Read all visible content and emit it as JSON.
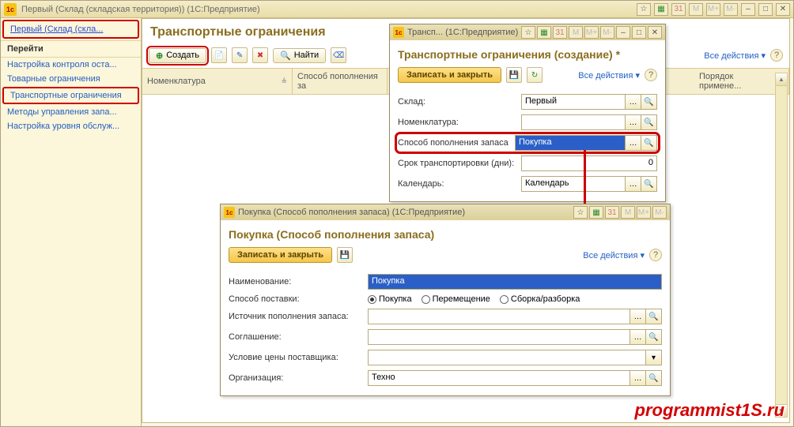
{
  "mainWindow": {
    "title": "Первый (Склад (складская территория)) (1С:Предприятие)"
  },
  "sidebar": {
    "title": "Первый (Склад (скла...",
    "section": "Перейти",
    "items": [
      "Настройка контроля оста...",
      "Товарные ограничения",
      "Транспортные ограничения",
      "Методы управления запа...",
      "Настройка уровня обслуж..."
    ]
  },
  "page": {
    "title": "Транспортные ограничения",
    "createBtn": "Создать",
    "findBtn": "Найти",
    "allActions": "Все действия",
    "cols": [
      "Номенклатура",
      "Способ пополнения за",
      "Порядок примене..."
    ]
  },
  "dlg1": {
    "titlebar": "Трансп... (1С:Предприятие)",
    "heading": "Транспортные ограничения (создание) *",
    "saveClose": "Записать и закрыть",
    "allActions": "Все действия",
    "rows": {
      "warehouse": {
        "label": "Склад:",
        "value": "Первый"
      },
      "nomen": {
        "label": "Номенклатура:",
        "value": ""
      },
      "method": {
        "label": "Способ пополнения запаса",
        "value": "Покупка"
      },
      "days": {
        "label": "Срок транспортировки (дни):",
        "value": "0"
      },
      "calendar": {
        "label": "Календарь:",
        "value": "Календарь"
      }
    }
  },
  "dlg2": {
    "titlebar": "Покупка (Способ пополнения запаса) (1С:Предприятие)",
    "heading": "Покупка (Способ пополнения запаса)",
    "saveClose": "Записать и закрыть",
    "allActions": "Все действия",
    "rows": {
      "name": {
        "label": "Наименование:",
        "value": "Покупка"
      },
      "supply": {
        "label": "Способ поставки:",
        "options": [
          "Покупка",
          "Перемещение",
          "Сборка/разборка"
        ],
        "selected": 0
      },
      "source": {
        "label": "Источник пополнения запаса:",
        "value": ""
      },
      "agreement": {
        "label": "Соглашение:",
        "value": ""
      },
      "price": {
        "label": "Условие цены поставщика:",
        "value": ""
      },
      "org": {
        "label": "Организация:",
        "value": "Техно"
      }
    }
  },
  "watermark": "programmist1S.ru"
}
